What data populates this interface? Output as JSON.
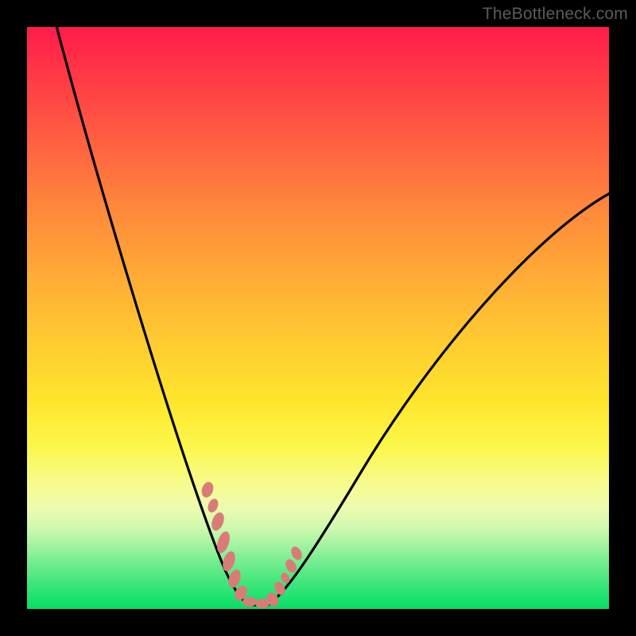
{
  "watermark": "TheBottleneck.com",
  "chart_data": {
    "type": "line",
    "title": "",
    "xlabel": "",
    "ylabel": "",
    "xlim": [
      0,
      100
    ],
    "ylim": [
      0,
      100
    ],
    "background_gradient": {
      "top_color": "#FF1B4A",
      "mid_color": "#FEE52C",
      "bottom_color": "#07DE63"
    },
    "series": [
      {
        "name": "bottleneck-curve",
        "stroke": "#000000",
        "x": [
          5,
          8,
          12,
          16,
          20,
          24,
          28,
          31,
          33,
          35,
          37,
          39,
          42,
          45,
          50,
          56,
          63,
          72,
          82,
          92,
          100
        ],
        "y": [
          100,
          90,
          78,
          66,
          54,
          42,
          30,
          20,
          12,
          6,
          1,
          0,
          0,
          2,
          8,
          16,
          26,
          38,
          50,
          62,
          70
        ]
      },
      {
        "name": "marker-dots",
        "stroke": "#D97C78",
        "type": "scatter",
        "x": [
          31.0,
          32.5,
          33.5,
          34.4,
          35.4,
          36.4,
          37.3,
          38.4,
          39.5,
          40.6,
          41.7,
          42.9,
          43.9,
          45.0,
          46.1
        ],
        "y": [
          20.5,
          17.0,
          13.5,
          10.5,
          7.5,
          5.0,
          3.0,
          1.5,
          1.0,
          1.0,
          1.0,
          1.5,
          3.2,
          6.0,
          9.5
        ]
      }
    ]
  }
}
